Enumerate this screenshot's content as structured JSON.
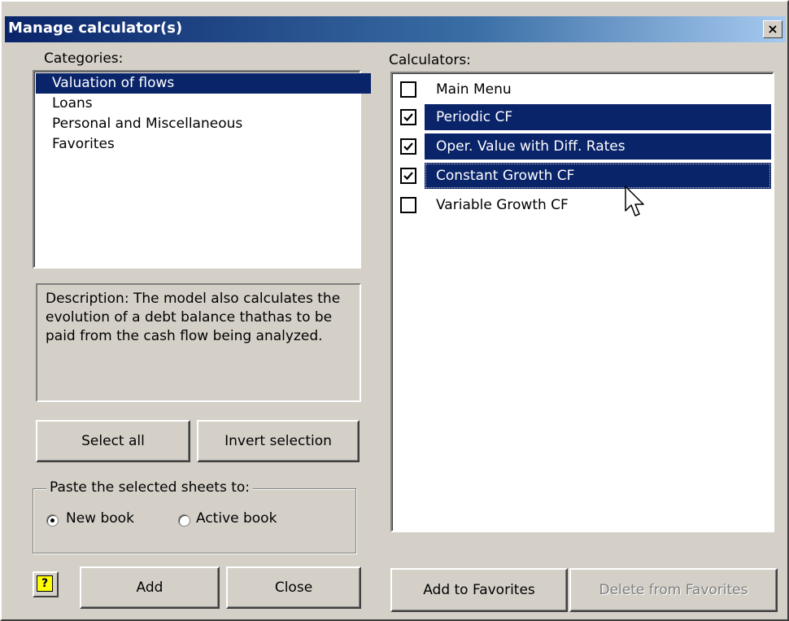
{
  "window": {
    "title": "Manage calculator(s)",
    "close_glyph": "×"
  },
  "categories": {
    "label": "Categories:",
    "items": [
      {
        "label": "Valuation of flows",
        "selected": true
      },
      {
        "label": "Loans",
        "selected": false
      },
      {
        "label": "Personal and Miscellaneous",
        "selected": false
      },
      {
        "label": "Favorites",
        "selected": false
      }
    ]
  },
  "description": {
    "text": "Description:  The model also calculates the evolution of a debt balance thathas to be paid from the cash flow being analyzed."
  },
  "calculators": {
    "label": "Calculators:",
    "items": [
      {
        "label": "Main Menu",
        "checked": false,
        "selected": false
      },
      {
        "label": "Periodic CF",
        "checked": true,
        "selected": true
      },
      {
        "label": "Oper. Value with Diff. Rates",
        "checked": true,
        "selected": true
      },
      {
        "label": "Constant Growth CF",
        "checked": true,
        "selected": true
      },
      {
        "label": "Variable Growth CF",
        "checked": false,
        "selected": false
      }
    ]
  },
  "buttons": {
    "select_all": "Select all",
    "invert_selection": "Invert selection",
    "help": "?",
    "add": "Add",
    "close": "Close",
    "add_to_favorites": "Add to Favorites",
    "delete_from_favorites": "Delete from  Favorites"
  },
  "paste_group": {
    "legend": "Paste the selected sheets to:",
    "options": [
      {
        "label": "New book",
        "selected": true
      },
      {
        "label": "Active book",
        "selected": false
      }
    ]
  },
  "colors": {
    "selection": "#0a246a",
    "face": "#d4d0c8"
  }
}
